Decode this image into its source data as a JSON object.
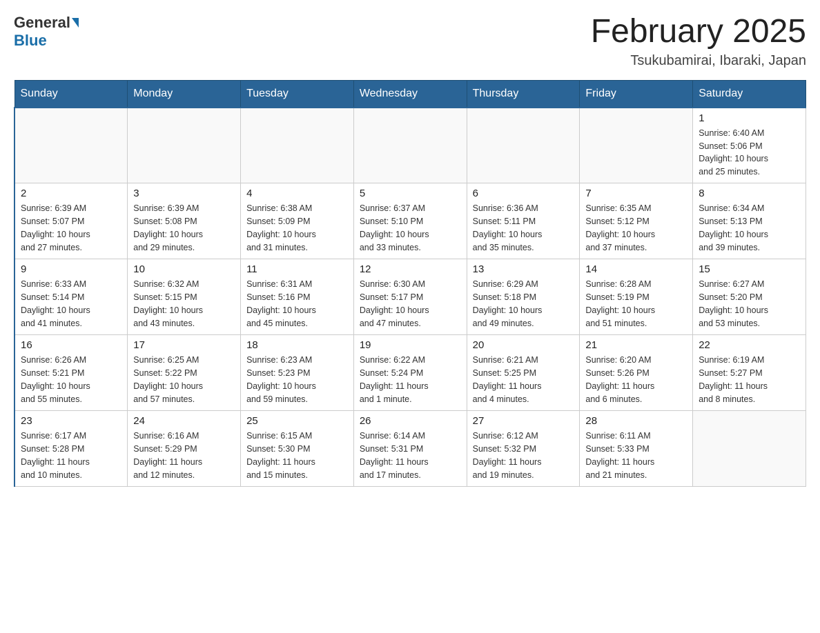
{
  "header": {
    "logo_general": "General",
    "logo_blue": "Blue",
    "month_title": "February 2025",
    "location": "Tsukubamirai, Ibaraki, Japan"
  },
  "days_of_week": [
    "Sunday",
    "Monday",
    "Tuesday",
    "Wednesday",
    "Thursday",
    "Friday",
    "Saturday"
  ],
  "weeks": [
    [
      {
        "day": "",
        "info": ""
      },
      {
        "day": "",
        "info": ""
      },
      {
        "day": "",
        "info": ""
      },
      {
        "day": "",
        "info": ""
      },
      {
        "day": "",
        "info": ""
      },
      {
        "day": "",
        "info": ""
      },
      {
        "day": "1",
        "info": "Sunrise: 6:40 AM\nSunset: 5:06 PM\nDaylight: 10 hours\nand 25 minutes."
      }
    ],
    [
      {
        "day": "2",
        "info": "Sunrise: 6:39 AM\nSunset: 5:07 PM\nDaylight: 10 hours\nand 27 minutes."
      },
      {
        "day": "3",
        "info": "Sunrise: 6:39 AM\nSunset: 5:08 PM\nDaylight: 10 hours\nand 29 minutes."
      },
      {
        "day": "4",
        "info": "Sunrise: 6:38 AM\nSunset: 5:09 PM\nDaylight: 10 hours\nand 31 minutes."
      },
      {
        "day": "5",
        "info": "Sunrise: 6:37 AM\nSunset: 5:10 PM\nDaylight: 10 hours\nand 33 minutes."
      },
      {
        "day": "6",
        "info": "Sunrise: 6:36 AM\nSunset: 5:11 PM\nDaylight: 10 hours\nand 35 minutes."
      },
      {
        "day": "7",
        "info": "Sunrise: 6:35 AM\nSunset: 5:12 PM\nDaylight: 10 hours\nand 37 minutes."
      },
      {
        "day": "8",
        "info": "Sunrise: 6:34 AM\nSunset: 5:13 PM\nDaylight: 10 hours\nand 39 minutes."
      }
    ],
    [
      {
        "day": "9",
        "info": "Sunrise: 6:33 AM\nSunset: 5:14 PM\nDaylight: 10 hours\nand 41 minutes."
      },
      {
        "day": "10",
        "info": "Sunrise: 6:32 AM\nSunset: 5:15 PM\nDaylight: 10 hours\nand 43 minutes."
      },
      {
        "day": "11",
        "info": "Sunrise: 6:31 AM\nSunset: 5:16 PM\nDaylight: 10 hours\nand 45 minutes."
      },
      {
        "day": "12",
        "info": "Sunrise: 6:30 AM\nSunset: 5:17 PM\nDaylight: 10 hours\nand 47 minutes."
      },
      {
        "day": "13",
        "info": "Sunrise: 6:29 AM\nSunset: 5:18 PM\nDaylight: 10 hours\nand 49 minutes."
      },
      {
        "day": "14",
        "info": "Sunrise: 6:28 AM\nSunset: 5:19 PM\nDaylight: 10 hours\nand 51 minutes."
      },
      {
        "day": "15",
        "info": "Sunrise: 6:27 AM\nSunset: 5:20 PM\nDaylight: 10 hours\nand 53 minutes."
      }
    ],
    [
      {
        "day": "16",
        "info": "Sunrise: 6:26 AM\nSunset: 5:21 PM\nDaylight: 10 hours\nand 55 minutes."
      },
      {
        "day": "17",
        "info": "Sunrise: 6:25 AM\nSunset: 5:22 PM\nDaylight: 10 hours\nand 57 minutes."
      },
      {
        "day": "18",
        "info": "Sunrise: 6:23 AM\nSunset: 5:23 PM\nDaylight: 10 hours\nand 59 minutes."
      },
      {
        "day": "19",
        "info": "Sunrise: 6:22 AM\nSunset: 5:24 PM\nDaylight: 11 hours\nand 1 minute."
      },
      {
        "day": "20",
        "info": "Sunrise: 6:21 AM\nSunset: 5:25 PM\nDaylight: 11 hours\nand 4 minutes."
      },
      {
        "day": "21",
        "info": "Sunrise: 6:20 AM\nSunset: 5:26 PM\nDaylight: 11 hours\nand 6 minutes."
      },
      {
        "day": "22",
        "info": "Sunrise: 6:19 AM\nSunset: 5:27 PM\nDaylight: 11 hours\nand 8 minutes."
      }
    ],
    [
      {
        "day": "23",
        "info": "Sunrise: 6:17 AM\nSunset: 5:28 PM\nDaylight: 11 hours\nand 10 minutes."
      },
      {
        "day": "24",
        "info": "Sunrise: 6:16 AM\nSunset: 5:29 PM\nDaylight: 11 hours\nand 12 minutes."
      },
      {
        "day": "25",
        "info": "Sunrise: 6:15 AM\nSunset: 5:30 PM\nDaylight: 11 hours\nand 15 minutes."
      },
      {
        "day": "26",
        "info": "Sunrise: 6:14 AM\nSunset: 5:31 PM\nDaylight: 11 hours\nand 17 minutes."
      },
      {
        "day": "27",
        "info": "Sunrise: 6:12 AM\nSunset: 5:32 PM\nDaylight: 11 hours\nand 19 minutes."
      },
      {
        "day": "28",
        "info": "Sunrise: 6:11 AM\nSunset: 5:33 PM\nDaylight: 11 hours\nand 21 minutes."
      },
      {
        "day": "",
        "info": ""
      }
    ]
  ]
}
